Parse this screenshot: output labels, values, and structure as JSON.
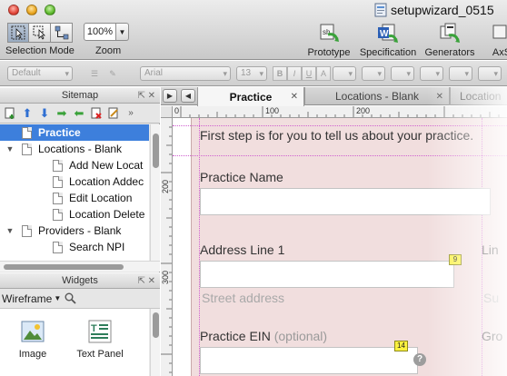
{
  "window": {
    "title": "setupwizard_0515"
  },
  "toolbar": {
    "selection_mode_label": "Selection Mode",
    "zoom_label": "Zoom",
    "zoom_value": "100%",
    "prototype_label": "Prototype",
    "specification_label": "Specification",
    "generators_label": "Generators",
    "axshare_label": "AxS"
  },
  "formatbar": {
    "style_value": "Default",
    "font_value": "Arial",
    "size_value": "13"
  },
  "sitemap": {
    "header": "Sitemap",
    "items": [
      {
        "label": "Practice",
        "level": 0,
        "selected": true,
        "expander": ""
      },
      {
        "label": "Locations - Blank",
        "level": 0,
        "selected": false,
        "expander": "▼"
      },
      {
        "label": "Add New Locat",
        "level": 1,
        "selected": false,
        "expander": ""
      },
      {
        "label": "Location Addec",
        "level": 1,
        "selected": false,
        "expander": ""
      },
      {
        "label": "Edit Location",
        "level": 1,
        "selected": false,
        "expander": ""
      },
      {
        "label": "Location Delete",
        "level": 1,
        "selected": false,
        "expander": ""
      },
      {
        "label": "Providers - Blank",
        "level": 0,
        "selected": false,
        "expander": "▼"
      },
      {
        "label": "Search NPI",
        "level": 1,
        "selected": false,
        "expander": ""
      }
    ]
  },
  "widgets": {
    "header": "Widgets",
    "library": "Wireframe",
    "items": [
      {
        "label": "Image",
        "icon": "image-icon"
      },
      {
        "label": "Text Panel",
        "icon": "text-panel-icon"
      }
    ]
  },
  "tabs": [
    {
      "label": "Practice",
      "active": true
    },
    {
      "label": "Locations - Blank",
      "active": false
    },
    {
      "label": "Location",
      "active": false
    }
  ],
  "rulers": {
    "h_labels": [
      "0",
      "100",
      "200"
    ],
    "v_labels": [
      "200",
      "300"
    ]
  },
  "canvas": {
    "intro": "First step is for you to tell us about your practice.",
    "practice_name_label": "Practice Name",
    "address_label": "Address Line 1",
    "address_hint": "Street address",
    "address_badge": "9",
    "ein_label": "Practice EIN",
    "ein_optional": "(optional)",
    "ein_badge": "14",
    "help_glyph": "?",
    "clipped_label_1": "Lin",
    "clipped_label_2": "Su",
    "clipped_label_3": "Gro"
  },
  "colors": {
    "selection": "#3d7fdc",
    "card_background": "#f1dede",
    "badge": "#fbf13f",
    "guide": "#d060d0"
  }
}
